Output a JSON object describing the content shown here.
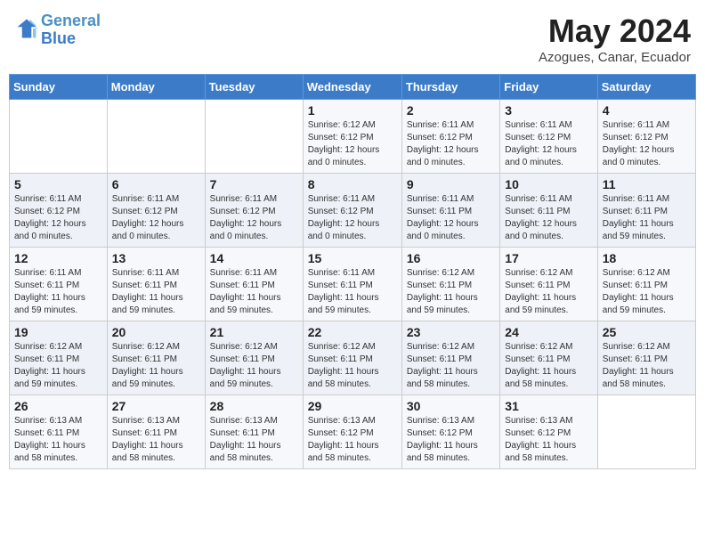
{
  "header": {
    "logo_line1": "General",
    "logo_line2": "Blue",
    "month": "May 2024",
    "location": "Azogues, Canar, Ecuador"
  },
  "weekdays": [
    "Sunday",
    "Monday",
    "Tuesday",
    "Wednesday",
    "Thursday",
    "Friday",
    "Saturday"
  ],
  "weeks": [
    [
      {
        "day": "",
        "info": ""
      },
      {
        "day": "",
        "info": ""
      },
      {
        "day": "",
        "info": ""
      },
      {
        "day": "1",
        "info": "Sunrise: 6:12 AM\nSunset: 6:12 PM\nDaylight: 12 hours\nand 0 minutes."
      },
      {
        "day": "2",
        "info": "Sunrise: 6:11 AM\nSunset: 6:12 PM\nDaylight: 12 hours\nand 0 minutes."
      },
      {
        "day": "3",
        "info": "Sunrise: 6:11 AM\nSunset: 6:12 PM\nDaylight: 12 hours\nand 0 minutes."
      },
      {
        "day": "4",
        "info": "Sunrise: 6:11 AM\nSunset: 6:12 PM\nDaylight: 12 hours\nand 0 minutes."
      }
    ],
    [
      {
        "day": "5",
        "info": "Sunrise: 6:11 AM\nSunset: 6:12 PM\nDaylight: 12 hours\nand 0 minutes."
      },
      {
        "day": "6",
        "info": "Sunrise: 6:11 AM\nSunset: 6:12 PM\nDaylight: 12 hours\nand 0 minutes."
      },
      {
        "day": "7",
        "info": "Sunrise: 6:11 AM\nSunset: 6:12 PM\nDaylight: 12 hours\nand 0 minutes."
      },
      {
        "day": "8",
        "info": "Sunrise: 6:11 AM\nSunset: 6:12 PM\nDaylight: 12 hours\nand 0 minutes."
      },
      {
        "day": "9",
        "info": "Sunrise: 6:11 AM\nSunset: 6:11 PM\nDaylight: 12 hours\nand 0 minutes."
      },
      {
        "day": "10",
        "info": "Sunrise: 6:11 AM\nSunset: 6:11 PM\nDaylight: 12 hours\nand 0 minutes."
      },
      {
        "day": "11",
        "info": "Sunrise: 6:11 AM\nSunset: 6:11 PM\nDaylight: 11 hours\nand 59 minutes."
      }
    ],
    [
      {
        "day": "12",
        "info": "Sunrise: 6:11 AM\nSunset: 6:11 PM\nDaylight: 11 hours\nand 59 minutes."
      },
      {
        "day": "13",
        "info": "Sunrise: 6:11 AM\nSunset: 6:11 PM\nDaylight: 11 hours\nand 59 minutes."
      },
      {
        "day": "14",
        "info": "Sunrise: 6:11 AM\nSunset: 6:11 PM\nDaylight: 11 hours\nand 59 minutes."
      },
      {
        "day": "15",
        "info": "Sunrise: 6:11 AM\nSunset: 6:11 PM\nDaylight: 11 hours\nand 59 minutes."
      },
      {
        "day": "16",
        "info": "Sunrise: 6:12 AM\nSunset: 6:11 PM\nDaylight: 11 hours\nand 59 minutes."
      },
      {
        "day": "17",
        "info": "Sunrise: 6:12 AM\nSunset: 6:11 PM\nDaylight: 11 hours\nand 59 minutes."
      },
      {
        "day": "18",
        "info": "Sunrise: 6:12 AM\nSunset: 6:11 PM\nDaylight: 11 hours\nand 59 minutes."
      }
    ],
    [
      {
        "day": "19",
        "info": "Sunrise: 6:12 AM\nSunset: 6:11 PM\nDaylight: 11 hours\nand 59 minutes."
      },
      {
        "day": "20",
        "info": "Sunrise: 6:12 AM\nSunset: 6:11 PM\nDaylight: 11 hours\nand 59 minutes."
      },
      {
        "day": "21",
        "info": "Sunrise: 6:12 AM\nSunset: 6:11 PM\nDaylight: 11 hours\nand 59 minutes."
      },
      {
        "day": "22",
        "info": "Sunrise: 6:12 AM\nSunset: 6:11 PM\nDaylight: 11 hours\nand 58 minutes."
      },
      {
        "day": "23",
        "info": "Sunrise: 6:12 AM\nSunset: 6:11 PM\nDaylight: 11 hours\nand 58 minutes."
      },
      {
        "day": "24",
        "info": "Sunrise: 6:12 AM\nSunset: 6:11 PM\nDaylight: 11 hours\nand 58 minutes."
      },
      {
        "day": "25",
        "info": "Sunrise: 6:12 AM\nSunset: 6:11 PM\nDaylight: 11 hours\nand 58 minutes."
      }
    ],
    [
      {
        "day": "26",
        "info": "Sunrise: 6:13 AM\nSunset: 6:11 PM\nDaylight: 11 hours\nand 58 minutes."
      },
      {
        "day": "27",
        "info": "Sunrise: 6:13 AM\nSunset: 6:11 PM\nDaylight: 11 hours\nand 58 minutes."
      },
      {
        "day": "28",
        "info": "Sunrise: 6:13 AM\nSunset: 6:11 PM\nDaylight: 11 hours\nand 58 minutes."
      },
      {
        "day": "29",
        "info": "Sunrise: 6:13 AM\nSunset: 6:12 PM\nDaylight: 11 hours\nand 58 minutes."
      },
      {
        "day": "30",
        "info": "Sunrise: 6:13 AM\nSunset: 6:12 PM\nDaylight: 11 hours\nand 58 minutes."
      },
      {
        "day": "31",
        "info": "Sunrise: 6:13 AM\nSunset: 6:12 PM\nDaylight: 11 hours\nand 58 minutes."
      },
      {
        "day": "",
        "info": ""
      }
    ]
  ]
}
